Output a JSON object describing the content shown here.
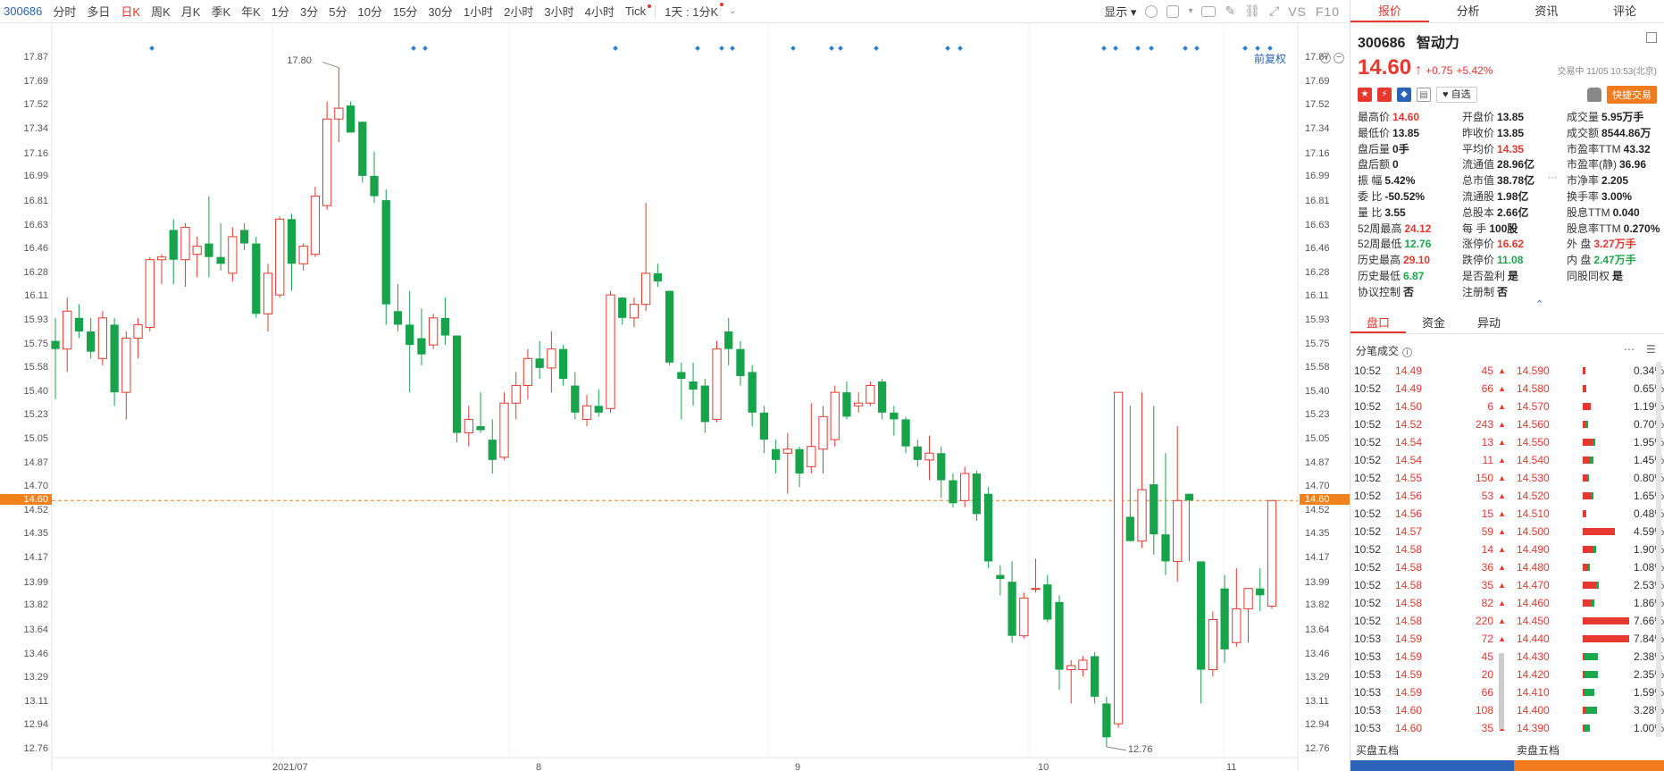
{
  "toolbar": {
    "code": "300686",
    "periods": [
      "分时",
      "多日",
      "日K",
      "周K",
      "月K",
      "季K",
      "年K",
      "1分",
      "3分",
      "5分",
      "10分",
      "15分",
      "30分",
      "1小时",
      "2小时",
      "3小时",
      "4小时",
      "Tick"
    ],
    "active_period": "日K",
    "period_select": "1天 : 1分K",
    "display_label": "显示",
    "f10_label": "F10",
    "vs_label": "VS"
  },
  "chart": {
    "fuquan_label": "前复权",
    "current_price_label": "14.60",
    "high_label": "17.80",
    "low_label": "12.76",
    "ytick_labels": [
      "17.87",
      "17.69",
      "17.52",
      "17.34",
      "17.16",
      "16.99",
      "16.81",
      "16.63",
      "16.46",
      "16.28",
      "16.11",
      "15.93",
      "15.75",
      "15.58",
      "15.40",
      "15.23",
      "15.05",
      "14.87",
      "14.70",
      "14.52",
      "14.35",
      "14.17",
      "13.99",
      "13.82",
      "13.64",
      "13.46",
      "13.29",
      "13.11",
      "12.94",
      "12.76"
    ],
    "xtick_labels": [
      "2021/07",
      "8",
      "9",
      "10",
      "11"
    ]
  },
  "chart_data": {
    "type": "candlestick",
    "ylim": [
      12.7,
      17.93
    ],
    "current_price": 14.6,
    "candles": [
      {
        "o": 15.78,
        "h": 15.95,
        "l": 15.35,
        "c": 15.72
      },
      {
        "o": 15.72,
        "h": 16.1,
        "l": 15.55,
        "c": 16.0
      },
      {
        "o": 15.95,
        "h": 16.05,
        "l": 15.8,
        "c": 15.85
      },
      {
        "o": 15.85,
        "h": 15.95,
        "l": 15.65,
        "c": 15.7
      },
      {
        "o": 15.65,
        "h": 16.0,
        "l": 15.6,
        "c": 15.95
      },
      {
        "o": 15.9,
        "h": 15.95,
        "l": 15.3,
        "c": 15.4
      },
      {
        "o": 15.4,
        "h": 15.85,
        "l": 15.2,
        "c": 15.8
      },
      {
        "o": 15.8,
        "h": 15.95,
        "l": 15.65,
        "c": 15.9
      },
      {
        "o": 15.88,
        "h": 16.4,
        "l": 15.85,
        "c": 16.38
      },
      {
        "o": 16.38,
        "h": 16.42,
        "l": 16.2,
        "c": 16.4
      },
      {
        "o": 16.6,
        "h": 16.68,
        "l": 16.2,
        "c": 16.38
      },
      {
        "o": 16.38,
        "h": 16.65,
        "l": 16.18,
        "c": 16.62
      },
      {
        "o": 16.42,
        "h": 16.55,
        "l": 16.25,
        "c": 16.48
      },
      {
        "o": 16.5,
        "h": 16.85,
        "l": 16.25,
        "c": 16.4
      },
      {
        "o": 16.4,
        "h": 16.65,
        "l": 16.3,
        "c": 16.35
      },
      {
        "o": 16.28,
        "h": 16.62,
        "l": 16.22,
        "c": 16.55
      },
      {
        "o": 16.6,
        "h": 16.65,
        "l": 16.45,
        "c": 16.5
      },
      {
        "o": 16.5,
        "h": 16.55,
        "l": 15.95,
        "c": 15.98
      },
      {
        "o": 15.98,
        "h": 16.35,
        "l": 15.85,
        "c": 16.28
      },
      {
        "o": 16.12,
        "h": 16.7,
        "l": 16.1,
        "c": 16.68
      },
      {
        "o": 16.68,
        "h": 16.72,
        "l": 16.15,
        "c": 16.35
      },
      {
        "o": 16.35,
        "h": 16.5,
        "l": 16.3,
        "c": 16.48
      },
      {
        "o": 16.42,
        "h": 16.92,
        "l": 16.4,
        "c": 16.85
      },
      {
        "o": 16.78,
        "h": 17.55,
        "l": 16.75,
        "c": 17.42
      },
      {
        "o": 17.42,
        "h": 17.8,
        "l": 17.25,
        "c": 17.5
      },
      {
        "o": 17.52,
        "h": 17.55,
        "l": 17.32,
        "c": 17.32
      },
      {
        "o": 17.4,
        "h": 17.4,
        "l": 16.95,
        "c": 17.0
      },
      {
        "o": 17.0,
        "h": 17.18,
        "l": 16.8,
        "c": 16.85
      },
      {
        "o": 16.82,
        "h": 16.9,
        "l": 15.9,
        "c": 16.05
      },
      {
        "o": 16.0,
        "h": 16.2,
        "l": 15.85,
        "c": 15.9
      },
      {
        "o": 15.9,
        "h": 16.15,
        "l": 15.4,
        "c": 15.75
      },
      {
        "o": 15.8,
        "h": 16.02,
        "l": 15.6,
        "c": 15.68
      },
      {
        "o": 15.75,
        "h": 15.98,
        "l": 15.72,
        "c": 15.95
      },
      {
        "o": 15.95,
        "h": 16.1,
        "l": 15.75,
        "c": 15.82
      },
      {
        "o": 15.82,
        "h": 15.82,
        "l": 15.03,
        "c": 15.1
      },
      {
        "o": 15.1,
        "h": 15.3,
        "l": 15.0,
        "c": 15.2
      },
      {
        "o": 15.15,
        "h": 15.4,
        "l": 15.1,
        "c": 15.12
      },
      {
        "o": 15.05,
        "h": 15.2,
        "l": 14.8,
        "c": 14.9
      },
      {
        "o": 14.92,
        "h": 15.4,
        "l": 14.9,
        "c": 15.32
      },
      {
        "o": 15.32,
        "h": 15.55,
        "l": 15.2,
        "c": 15.45
      },
      {
        "o": 15.45,
        "h": 15.72,
        "l": 15.35,
        "c": 15.65
      },
      {
        "o": 15.65,
        "h": 15.78,
        "l": 15.5,
        "c": 15.58
      },
      {
        "o": 15.58,
        "h": 15.85,
        "l": 15.4,
        "c": 15.72
      },
      {
        "o": 15.72,
        "h": 15.75,
        "l": 15.45,
        "c": 15.5
      },
      {
        "o": 15.45,
        "h": 15.55,
        "l": 15.2,
        "c": 15.25
      },
      {
        "o": 15.2,
        "h": 15.38,
        "l": 15.15,
        "c": 15.3
      },
      {
        "o": 15.3,
        "h": 15.42,
        "l": 15.22,
        "c": 15.25
      },
      {
        "o": 15.28,
        "h": 16.15,
        "l": 15.25,
        "c": 16.12
      },
      {
        "o": 16.1,
        "h": 16.1,
        "l": 15.9,
        "c": 15.95
      },
      {
        "o": 15.95,
        "h": 16.1,
        "l": 15.88,
        "c": 16.05
      },
      {
        "o": 16.05,
        "h": 16.8,
        "l": 16.0,
        "c": 16.28
      },
      {
        "o": 16.28,
        "h": 16.35,
        "l": 16.18,
        "c": 16.22
      },
      {
        "o": 16.15,
        "h": 16.15,
        "l": 15.6,
        "c": 15.62
      },
      {
        "o": 15.55,
        "h": 15.62,
        "l": 15.2,
        "c": 15.5
      },
      {
        "o": 15.48,
        "h": 15.62,
        "l": 15.3,
        "c": 15.42
      },
      {
        "o": 15.45,
        "h": 15.5,
        "l": 15.1,
        "c": 15.18
      },
      {
        "o": 15.2,
        "h": 15.78,
        "l": 15.18,
        "c": 15.72
      },
      {
        "o": 15.85,
        "h": 15.95,
        "l": 15.6,
        "c": 15.72
      },
      {
        "o": 15.72,
        "h": 15.78,
        "l": 15.45,
        "c": 15.52
      },
      {
        "o": 15.55,
        "h": 15.6,
        "l": 15.15,
        "c": 15.25
      },
      {
        "o": 15.25,
        "h": 15.3,
        "l": 14.95,
        "c": 15.05
      },
      {
        "o": 14.98,
        "h": 15.05,
        "l": 14.8,
        "c": 14.9
      },
      {
        "o": 14.95,
        "h": 15.1,
        "l": 14.65,
        "c": 14.98
      },
      {
        "o": 14.98,
        "h": 15.0,
        "l": 14.7,
        "c": 14.8
      },
      {
        "o": 14.85,
        "h": 15.32,
        "l": 14.8,
        "c": 15.0
      },
      {
        "o": 14.98,
        "h": 15.3,
        "l": 14.8,
        "c": 15.22
      },
      {
        "o": 15.05,
        "h": 15.45,
        "l": 15.0,
        "c": 15.4
      },
      {
        "o": 15.4,
        "h": 15.48,
        "l": 15.2,
        "c": 15.22
      },
      {
        "o": 15.3,
        "h": 15.4,
        "l": 15.25,
        "c": 15.32
      },
      {
        "o": 15.32,
        "h": 15.48,
        "l": 15.3,
        "c": 15.45
      },
      {
        "o": 15.48,
        "h": 15.5,
        "l": 15.2,
        "c": 15.25
      },
      {
        "o": 15.25,
        "h": 15.3,
        "l": 15.08,
        "c": 15.2
      },
      {
        "o": 15.2,
        "h": 15.22,
        "l": 14.95,
        "c": 15.0
      },
      {
        "o": 15.0,
        "h": 15.05,
        "l": 14.85,
        "c": 14.9
      },
      {
        "o": 14.9,
        "h": 15.08,
        "l": 14.75,
        "c": 14.95
      },
      {
        "o": 14.95,
        "h": 15.0,
        "l": 14.62,
        "c": 14.75
      },
      {
        "o": 14.75,
        "h": 14.8,
        "l": 14.55,
        "c": 14.58
      },
      {
        "o": 14.6,
        "h": 14.85,
        "l": 14.55,
        "c": 14.8
      },
      {
        "o": 14.8,
        "h": 14.82,
        "l": 14.45,
        "c": 14.5
      },
      {
        "o": 14.65,
        "h": 14.7,
        "l": 14.1,
        "c": 14.15
      },
      {
        "o": 14.05,
        "h": 14.12,
        "l": 13.9,
        "c": 14.02
      },
      {
        "o": 14.0,
        "h": 14.15,
        "l": 13.55,
        "c": 13.6
      },
      {
        "o": 13.6,
        "h": 13.92,
        "l": 13.58,
        "c": 13.88
      },
      {
        "o": 13.95,
        "h": 14.17,
        "l": 13.92,
        "c": 13.95
      },
      {
        "o": 13.98,
        "h": 14.05,
        "l": 13.7,
        "c": 13.72
      },
      {
        "o": 13.85,
        "h": 13.9,
        "l": 13.2,
        "c": 13.35
      },
      {
        "o": 13.35,
        "h": 13.42,
        "l": 13.1,
        "c": 13.38
      },
      {
        "o": 13.35,
        "h": 13.45,
        "l": 13.3,
        "c": 13.42
      },
      {
        "o": 13.45,
        "h": 13.48,
        "l": 13.1,
        "c": 13.15
      },
      {
        "o": 13.1,
        "h": 13.15,
        "l": 12.78,
        "c": 12.85
      },
      {
        "o": 12.95,
        "h": 15.4,
        "l": 12.92,
        "c": 15.4
      },
      {
        "o": 14.48,
        "h": 15.3,
        "l": 14.3,
        "c": 14.3
      },
      {
        "o": 14.3,
        "h": 15.4,
        "l": 14.25,
        "c": 14.68
      },
      {
        "o": 14.72,
        "h": 15.3,
        "l": 14.2,
        "c": 14.35
      },
      {
        "o": 14.35,
        "h": 14.95,
        "l": 14.05,
        "c": 14.15
      },
      {
        "o": 14.15,
        "h": 15.15,
        "l": 14.0,
        "c": 14.6
      },
      {
        "o": 14.65,
        "h": 14.65,
        "l": 14.15,
        "c": 14.6
      },
      {
        "o": 14.15,
        "h": 14.15,
        "l": 13.1,
        "c": 13.35
      },
      {
        "o": 13.35,
        "h": 13.78,
        "l": 13.3,
        "c": 13.72
      },
      {
        "o": 13.95,
        "h": 14.05,
        "l": 13.4,
        "c": 13.5
      },
      {
        "o": 13.55,
        "h": 14.1,
        "l": 13.52,
        "c": 13.8
      },
      {
        "o": 13.8,
        "h": 13.95,
        "l": 13.55,
        "c": 13.95
      },
      {
        "o": 13.95,
        "h": 14.1,
        "l": 13.78,
        "c": 13.9
      },
      {
        "o": 13.82,
        "h": 14.6,
        "l": 13.8,
        "c": 14.6
      }
    ]
  },
  "panel": {
    "tabs": [
      "报价",
      "分析",
      "资讯",
      "评论"
    ],
    "active_tab": "报价",
    "code": "300686",
    "name": "智动力",
    "price": "14.60",
    "change": "+0.75",
    "change_pct": "+5.42%",
    "status": "交易中 11/05 10:53(北京)",
    "zixuan": "自选",
    "fast_trade": "快捷交易",
    "quote_rows": [
      [
        {
          "k": "最高价",
          "v": "14.60",
          "c": "red"
        },
        {
          "k": "开盘价",
          "v": "13.85",
          "c": ""
        },
        {
          "k": "成交量",
          "v": "5.95万手",
          "c": ""
        }
      ],
      [
        {
          "k": "最低价",
          "v": "13.85",
          "c": ""
        },
        {
          "k": "昨收价",
          "v": "13.85",
          "c": ""
        },
        {
          "k": "成交额",
          "v": "8544.86万",
          "c": ""
        }
      ],
      [
        {
          "k": "盘后量",
          "v": "0手",
          "c": ""
        },
        {
          "k": "平均价",
          "v": "14.35",
          "c": "red"
        },
        {
          "k": "市盈率TTM",
          "v": "43.32",
          "c": ""
        }
      ],
      [
        {
          "k": "盘后额",
          "v": "0",
          "c": ""
        },
        {
          "k": "流通值",
          "v": "28.96亿",
          "c": ""
        },
        {
          "k": "市盈率(静)",
          "v": "36.96",
          "c": ""
        }
      ],
      [
        {
          "k": "振 幅",
          "v": "5.42%",
          "c": ""
        },
        {
          "k": "总市值",
          "v": "38.78亿",
          "c": ""
        },
        {
          "k": "市净率",
          "v": "2.205",
          "c": ""
        }
      ],
      [
        {
          "k": "委 比",
          "v": "-50.52%",
          "c": ""
        },
        {
          "k": "流通股",
          "v": "1.98亿",
          "c": ""
        },
        {
          "k": "换手率",
          "v": "3.00%",
          "c": ""
        }
      ],
      [
        {
          "k": "量 比",
          "v": "3.55",
          "c": ""
        },
        {
          "k": "总股本",
          "v": "2.66亿",
          "c": ""
        },
        {
          "k": "股息TTM",
          "v": "0.040",
          "c": ""
        }
      ],
      [
        {
          "k": "52周最高",
          "v": "24.12",
          "c": "red"
        },
        {
          "k": "每 手",
          "v": "100股",
          "c": ""
        },
        {
          "k": "股息率TTM",
          "v": "0.270%",
          "c": ""
        }
      ],
      [
        {
          "k": "52周最低",
          "v": "12.76",
          "c": "green"
        },
        {
          "k": "涨停价",
          "v": "16.62",
          "c": "red"
        },
        {
          "k": "外 盘",
          "v": "3.27万手",
          "c": "red"
        }
      ],
      [
        {
          "k": "历史最高",
          "v": "29.10",
          "c": "red"
        },
        {
          "k": "跌停价",
          "v": "11.08",
          "c": "green"
        },
        {
          "k": "内 盘",
          "v": "2.47万手",
          "c": "green"
        }
      ],
      [
        {
          "k": "历史最低",
          "v": "6.87",
          "c": "green"
        },
        {
          "k": "是否盈利",
          "v": "是",
          "c": ""
        },
        {
          "k": "同股同权",
          "v": "是",
          "c": ""
        }
      ],
      [
        {
          "k": "协议控制",
          "v": "否",
          "c": ""
        },
        {
          "k": "注册制",
          "v": "否",
          "c": ""
        },
        {
          "k": "",
          "v": "",
          "c": ""
        }
      ]
    ],
    "sub_tabs": [
      "盘口",
      "资金",
      "异动"
    ],
    "trades_title": "分笔成交",
    "trades": [
      {
        "t": "10:52",
        "p": "14.49",
        "v": "45"
      },
      {
        "t": "10:52",
        "p": "14.49",
        "v": "66"
      },
      {
        "t": "10:52",
        "p": "14.50",
        "v": "6"
      },
      {
        "t": "10:52",
        "p": "14.52",
        "v": "243"
      },
      {
        "t": "10:52",
        "p": "14.54",
        "v": "13"
      },
      {
        "t": "10:52",
        "p": "14.54",
        "v": "11"
      },
      {
        "t": "10:52",
        "p": "14.55",
        "v": "150"
      },
      {
        "t": "10:52",
        "p": "14.56",
        "v": "53"
      },
      {
        "t": "10:52",
        "p": "14.56",
        "v": "15"
      },
      {
        "t": "10:52",
        "p": "14.57",
        "v": "59"
      },
      {
        "t": "10:52",
        "p": "14.58",
        "v": "14"
      },
      {
        "t": "10:52",
        "p": "14.58",
        "v": "36"
      },
      {
        "t": "10:52",
        "p": "14.58",
        "v": "35"
      },
      {
        "t": "10:52",
        "p": "14.58",
        "v": "82"
      },
      {
        "t": "10:52",
        "p": "14.58",
        "v": "220"
      },
      {
        "t": "10:53",
        "p": "14.59",
        "v": "72"
      },
      {
        "t": "10:53",
        "p": "14.59",
        "v": "45"
      },
      {
        "t": "10:53",
        "p": "14.59",
        "v": "20"
      },
      {
        "t": "10:53",
        "p": "14.59",
        "v": "66"
      },
      {
        "t": "10:53",
        "p": "14.60",
        "v": "108"
      },
      {
        "t": "10:53",
        "p": "14.60",
        "v": "35"
      }
    ],
    "depth": [
      {
        "p": "14.590",
        "pct": "0.34%",
        "r": 0.06,
        "g": 0.0
      },
      {
        "p": "14.580",
        "pct": "0.65%",
        "r": 0.08,
        "g": 0.0
      },
      {
        "p": "14.570",
        "pct": "1.19%",
        "r": 0.18,
        "g": 0.0
      },
      {
        "p": "14.560",
        "pct": "0.70%",
        "r": 0.07,
        "g": 0.05
      },
      {
        "p": "14.550",
        "pct": "1.95%",
        "r": 0.22,
        "g": 0.06
      },
      {
        "p": "14.540",
        "pct": "1.45%",
        "r": 0.15,
        "g": 0.08
      },
      {
        "p": "14.530",
        "pct": "0.80%",
        "r": 0.1,
        "g": 0.03
      },
      {
        "p": "14.520",
        "pct": "1.65%",
        "r": 0.18,
        "g": 0.06
      },
      {
        "p": "14.510",
        "pct": "0.48%",
        "r": 0.06,
        "g": 0.02
      },
      {
        "p": "14.500",
        "pct": "4.59%",
        "r": 0.7,
        "g": 0.0
      },
      {
        "p": "14.490",
        "pct": "1.90%",
        "r": 0.24,
        "g": 0.05
      },
      {
        "p": "14.480",
        "pct": "1.08%",
        "r": 0.12,
        "g": 0.04
      },
      {
        "p": "14.470",
        "pct": "2.53%",
        "r": 0.3,
        "g": 0.05
      },
      {
        "p": "14.460",
        "pct": "1.86%",
        "r": 0.2,
        "g": 0.06
      },
      {
        "p": "14.450",
        "pct": "7.66%",
        "r": 1.0,
        "g": 0.0
      },
      {
        "p": "14.440",
        "pct": "7.84%",
        "r": 1.0,
        "g": 0.0
      },
      {
        "p": "14.430",
        "pct": "2.38%",
        "r": 0.05,
        "g": 0.28
      },
      {
        "p": "14.420",
        "pct": "2.35%",
        "r": 0.05,
        "g": 0.28
      },
      {
        "p": "14.410",
        "pct": "1.59%",
        "r": 0.05,
        "g": 0.2
      },
      {
        "p": "14.400",
        "pct": "3.28%",
        "r": 0.08,
        "g": 0.24
      },
      {
        "p": "14.390",
        "pct": "1.00%",
        "r": 0.05,
        "g": 0.1
      }
    ],
    "buy_five": "买盘五档",
    "sell_five": "卖盘五档",
    "colors": {
      "red": "#e6382e",
      "green": "#1aa84b",
      "blue": "#2a63b8",
      "orange": "#f07a1c"
    }
  }
}
